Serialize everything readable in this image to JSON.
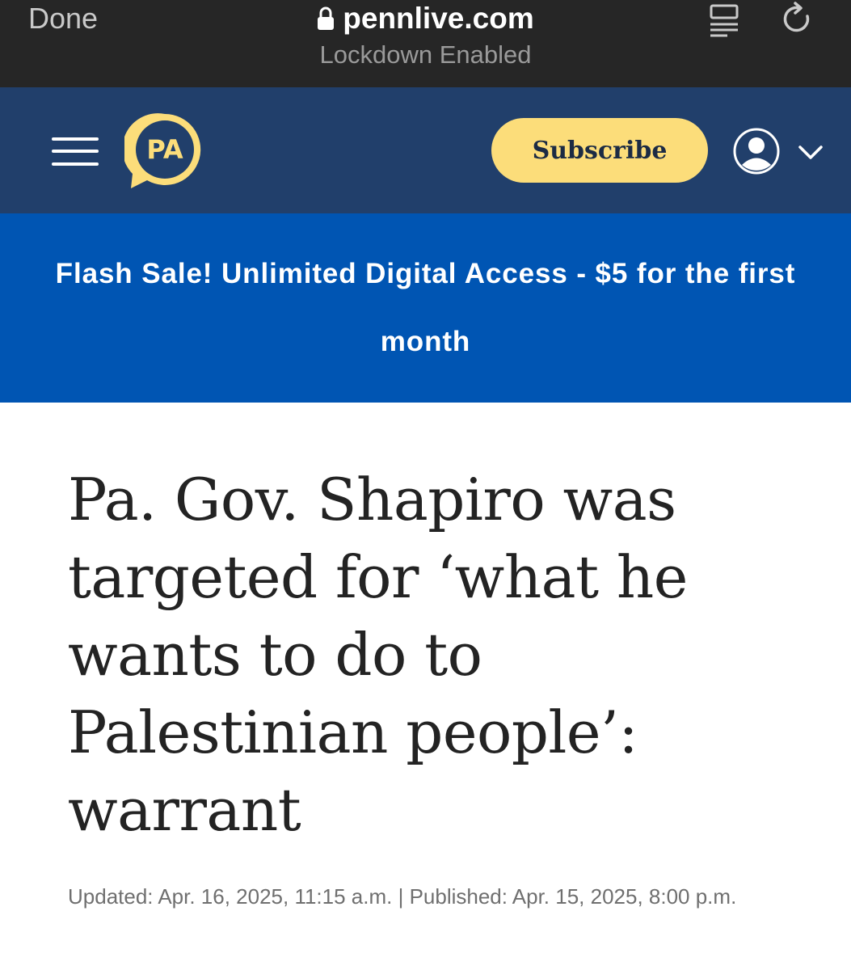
{
  "browser": {
    "done_label": "Done",
    "url": "pennlive.com",
    "status": "Lockdown Enabled"
  },
  "header": {
    "logo_text": "PA",
    "subscribe_label": "Subscribe",
    "brand_colors": {
      "header_bg": "#213f6b",
      "accent": "#fcdd7a"
    }
  },
  "promo": {
    "text": "Flash Sale! Unlimited Digital Access - $5 for the first month",
    "bg_color": "#0055b3"
  },
  "article": {
    "headline": "Pa. Gov. Shapiro was targeted for ‘what he wants to do to Palestinian people’: warrant",
    "dateline": "Updated: Apr. 16, 2025, 11:15 a.m. | Published: Apr. 15, 2025, 8:00 p.m."
  },
  "icons": [
    "lock-icon",
    "reader-icon",
    "reload-icon",
    "hamburger-menu-icon",
    "account-icon",
    "chevron-down-icon"
  ]
}
